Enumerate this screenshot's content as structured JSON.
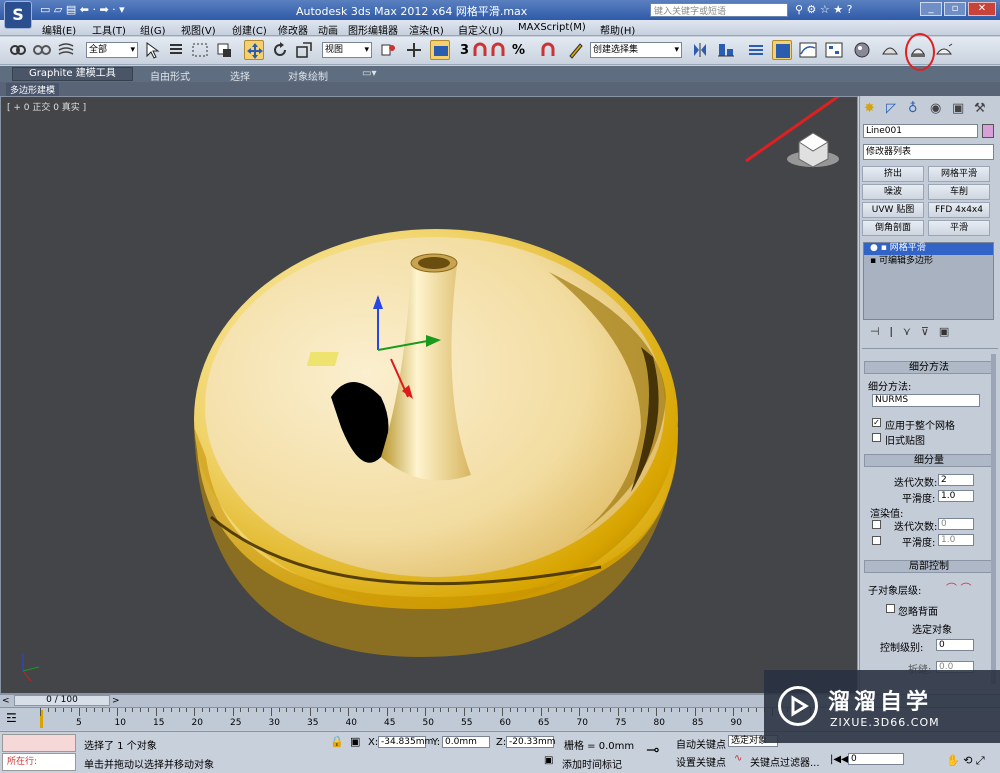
{
  "window": {
    "title": "Autodesk 3ds Max  2012 x64    网格平滑.max",
    "search_placeholder": "键入关键字或短语"
  },
  "menu": [
    "编辑(E)",
    "工具(T)",
    "组(G)",
    "视图(V)",
    "创建(C)",
    "修改器",
    "动画",
    "图形编辑器",
    "渲染(R)",
    "自定义(U)",
    "MAXScript(M)",
    "帮助(H)"
  ],
  "toolbar": {
    "selection_filter": "全部",
    "ref_coord": "视图",
    "named_selection": "创建选择集",
    "snap_labels": [
      "3",
      "%"
    ]
  },
  "ribbon": {
    "tabs": [
      "Graphite 建模工具",
      "自由形式",
      "选择",
      "对象绘制"
    ],
    "subtab": "多边形建模"
  },
  "viewport": {
    "label": "[ + 0 正交 0 真实 ]"
  },
  "command_panel": {
    "object_name": "Line001",
    "object_color": "#d8a0d8",
    "modifier_list_label": "修改器列表",
    "buttons": [
      "挤出",
      "网格平滑",
      "噪波",
      "车削",
      "UVW 贴图",
      "FFD 4x4x4",
      "倒角剖面",
      "平滑"
    ],
    "stack": [
      "网格平滑",
      "可编辑多边形"
    ],
    "rollouts": {
      "subdivision_method": {
        "title": "细分方法",
        "label": "细分方法:",
        "value": "NURMS",
        "apply_whole": "应用于整个网格",
        "old_style": "旧式贴图",
        "apply_checked": true,
        "old_checked": false
      },
      "subdivision_amount": {
        "title": "细分量",
        "iterations_label": "迭代次数:",
        "iterations": "2",
        "smoothness_label": "平滑度:",
        "smoothness": "1.0",
        "render_label": "渲染值:",
        "r_iterations": "0",
        "r_smoothness": "1.0"
      },
      "local_control": {
        "title": "局部控制",
        "sublevel_label": "子对象层级:",
        "ignore_back": "忽略背面",
        "selected": "选定对象",
        "control_level_label": "控制级别:",
        "control_level": "0",
        "crease_label": "折缝:",
        "crease": "0.0"
      }
    }
  },
  "timeline": {
    "frame": "0 / 100",
    "ticks": [
      "5",
      "10",
      "15",
      "20",
      "25",
      "30",
      "35",
      "40",
      "45",
      "50",
      "55",
      "60",
      "65",
      "70",
      "75",
      "80",
      "85",
      "90"
    ]
  },
  "status": {
    "mode": "所在行:",
    "selected": "选择了 1 个对象",
    "prompt": "单击并拖动以选择并移动对象",
    "x_label": "X:",
    "x": "-34.835mm",
    "y_label": "Y:",
    "y": "0.0mm",
    "z_label": "Z:",
    "z": "-20.33mm",
    "grid": "栅格 = 0.0mm",
    "add_tag": "添加时间标记",
    "auto_key": "自动关键点",
    "set_key": "设置关键点",
    "sel_obj": "选定对象",
    "key_filter": "关键点过滤器...",
    "frame_field": "0"
  },
  "watermark": {
    "brand": "溜溜自学",
    "url": "ZIXUE.3D66.COM"
  },
  "annotation": {
    "color": "#e02020"
  }
}
